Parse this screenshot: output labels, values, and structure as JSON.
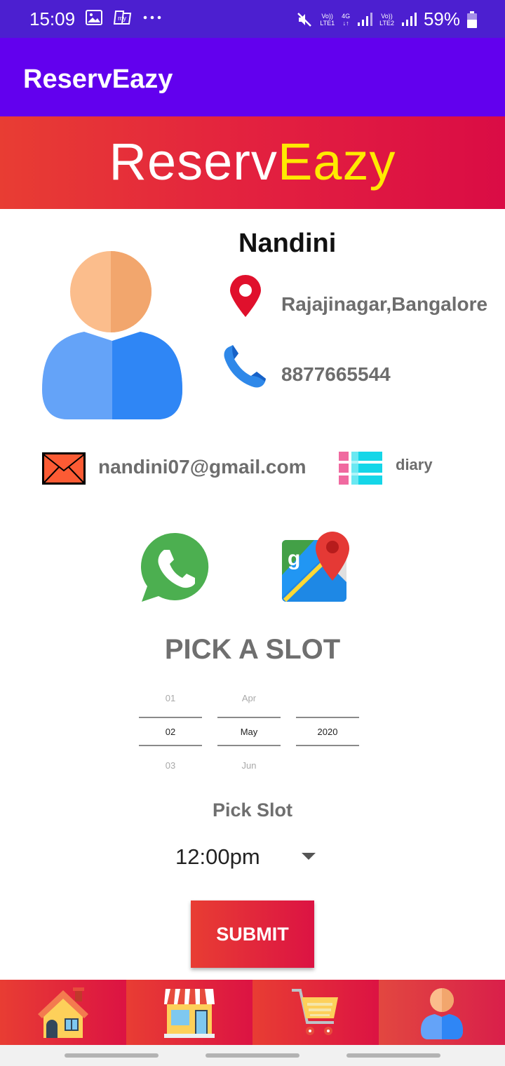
{
  "status_bar": {
    "time": "15:09",
    "network_1_top": "Vo))",
    "network_1_bottom": "LTE1",
    "network_4g": "4G",
    "network_2_top": "Vo))",
    "network_2_bottom": "LTE2",
    "battery": "59%",
    "icons": [
      "image-icon",
      "paytm-icon",
      "more-icon",
      "mute-icon",
      "signal-icon",
      "battery-icon"
    ]
  },
  "app_bar": {
    "title": "ReservEazy"
  },
  "banner": {
    "logo_part1": "Reserv",
    "logo_part2": "Eazy"
  },
  "profile": {
    "name": "Nandini",
    "location": "Rajajinagar,Bangalore",
    "phone": "8877665544",
    "email": "nandini07@gmail.com",
    "category": "diary"
  },
  "actions": {
    "icons": [
      "whatsapp-icon",
      "google-maps-icon"
    ]
  },
  "slot_picker": {
    "title": "PICK A SLOT",
    "day": {
      "prev": "01",
      "selected": "02",
      "next": "03"
    },
    "month": {
      "prev": "Apr",
      "selected": "May",
      "next": "Jun"
    },
    "year": {
      "selected": "2020"
    },
    "slot_label": "Pick Slot",
    "slot_value": "12:00pm",
    "submit_label": "SUBMIT"
  },
  "bottom_nav": {
    "items": [
      {
        "name": "home",
        "icon": "home-icon"
      },
      {
        "name": "shop",
        "icon": "shop-icon"
      },
      {
        "name": "cart",
        "icon": "cart-icon"
      },
      {
        "name": "profile",
        "icon": "user-icon"
      }
    ],
    "active_index": 3
  },
  "colors": {
    "status_bar": "#4c1fd0",
    "app_bar": "#6200ee",
    "brand_red": "#e3213f",
    "logo_highlight": "#ffea00",
    "muted_text": "#6d6d6d"
  }
}
